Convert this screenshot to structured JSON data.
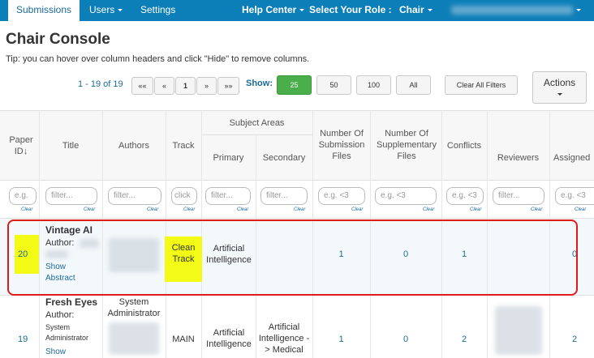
{
  "nav": {
    "tabs": [
      "Submissions",
      "Users",
      "Settings"
    ],
    "help_center": "Help Center",
    "select_role": "Select Your Role :",
    "role": "Chair"
  },
  "page": {
    "title": "Chair Console",
    "tip": "Tip: you can hover over column headers and click \"Hide\" to remove columns."
  },
  "pager": {
    "info": "1 - 19 of 19",
    "buttons": [
      "««",
      "«",
      "1",
      "»",
      "»»"
    ],
    "show_label": "Show:",
    "sizes": [
      "25",
      "50",
      "100",
      "All"
    ],
    "clear_filters": "Clear All Filters",
    "actions": "Actions"
  },
  "table": {
    "headers": {
      "paper_id": "Paper ID",
      "title": "Title",
      "authors": "Authors",
      "track": "Track",
      "subject_areas": "Subject Areas",
      "primary": "Primary",
      "secondary": "Secondary",
      "num_submission_files": "Number Of Submission Files",
      "num_supplementary_files": "Number Of Supplementary Files",
      "conflicts": "Conflicts",
      "reviewers": "Reviewers",
      "assigned": "Assigned"
    },
    "filters": {
      "paper_id": "e.g.",
      "title": "filter...",
      "authors": "filter...",
      "track": "click",
      "primary": "filter...",
      "secondary": "filter...",
      "num_submission_files": "e.g. <3",
      "num_supplementary_files": "e.g. <3",
      "conflicts": "e.g. <3",
      "reviewers": "filter...",
      "assigned": "e.g. <3"
    },
    "clear_label": "Clear",
    "rows": [
      {
        "paper_id": "20",
        "title": "Vintage AI",
        "author_label": "Author:",
        "show_abstract": "Show Abstract",
        "track": "Clean Track",
        "primary": "Artificial Intelligence",
        "secondary": "",
        "submission_files": "1",
        "supplementary_files": "0",
        "conflicts": "1",
        "assigned": "0"
      },
      {
        "paper_id": "19",
        "title": "Fresh Eyes",
        "author_label": "Author:",
        "author_name": "System Administrator",
        "show_abstract": "Show",
        "authors": "System Administrator",
        "track": "MAIN",
        "primary": "Artificial Intelligence",
        "secondary": "Artificial Intelligence -> Medical",
        "submission_files": "1",
        "supplementary_files": "0",
        "conflicts": "2",
        "assigned": "2"
      }
    ]
  },
  "colors": {
    "nav_bg": "#0d7fb8",
    "link": "#1b6a98",
    "highlight": "#f2fa16",
    "annotation": "#e01b1b",
    "green": "#4aae4a"
  }
}
